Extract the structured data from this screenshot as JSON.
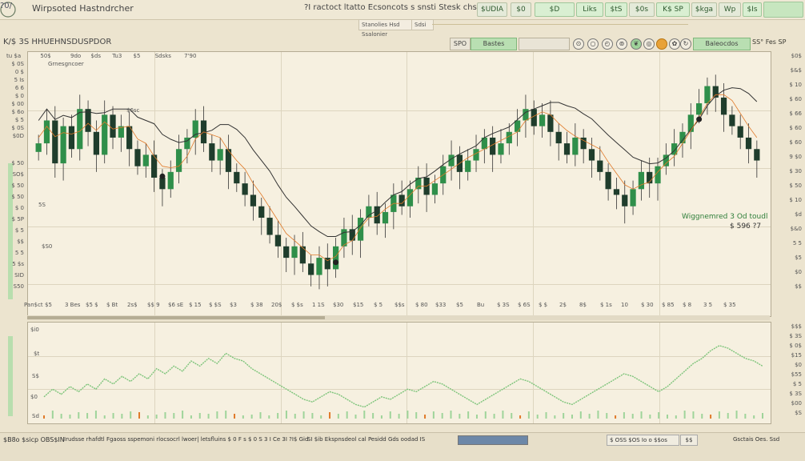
{
  "app": {
    "logo": "?0/",
    "title": "Wirpsoted Hastndrcher",
    "top_center": "?I ractoct ltatto Ecsoncots s snsti   Stesk  chs",
    "symbol_badge": "$UDIA"
  },
  "top_chips": [
    "$0",
    "$D",
    "Liks",
    "$tS",
    "$0s",
    "K$ SP",
    "$kga",
    "Wp",
    "$Is"
  ],
  "sub_fields": [
    "Stanolies Hsd Ssalonier",
    "Sdsi"
  ],
  "toolbar": {
    "symbol": "K/$ 3S HHUEHNSDUSPDOR",
    "btn_left": "SPO",
    "btn_left_green": "Bastes",
    "btn_right_green": "Baleocdos",
    "right_text": "SS° Fes SP"
  },
  "chart_header": [
    "tu $a",
    "50$",
    "9do",
    "$ds",
    "Tu3",
    "$5",
    "Sdsks",
    "7'90"
  ],
  "chart_note": "Grnesgncoer",
  "chart_note2": "$6sc",
  "annotation": {
    "line1": "Wiggnemred 3  Od toudl",
    "line2": "$ 596 ?7"
  },
  "price_axis": [
    "$0$",
    "$&$",
    "$ 10",
    "$ 60",
    "$ 66",
    "$ 60",
    "$ 60",
    "9 $0",
    "$ 30",
    "$ 50",
    "$ 10",
    "$d",
    "$&0",
    "5 5",
    "$5",
    "$0",
    "$$"
  ],
  "left_axis_upper": [
    "$ 0S",
    "0 $",
    "5 Is",
    "6 6",
    "$ 0",
    "$ 00",
    "$ 6o",
    "$ 5",
    "$ 0S",
    "$0D"
  ],
  "left_axis_lower": [
    "$ 50",
    "SO$",
    "$ 50",
    "$ 50",
    "$ 0",
    "$ 5P",
    "$ 5",
    "$$",
    "5 5",
    "5 $s",
    "SID",
    "S50"
  ],
  "mid_labels": [
    "5S",
    "$S0"
  ],
  "x_axis_labels": [
    "Pan$ct",
    "$5",
    "3 Bes",
    "$5 $",
    "$ Bt",
    "2s$",
    "$$ 9",
    "$6 sE",
    "$ 15",
    "$ $S",
    "$3",
    "$ 38",
    "20$",
    "$ $s",
    "1 1S",
    "$30",
    "$15",
    "$ 5",
    "$$s",
    "$ 80",
    "$33",
    "$5",
    "Bu",
    "$ 3S",
    "$ 6S",
    "$ $",
    "2$",
    "8$",
    "$ 1s",
    "10",
    "$ 30",
    "$ 85",
    "$ 8",
    "3 5",
    "$ 35"
  ],
  "lower_panel_labels": [
    "$i0",
    "$t",
    "S$",
    "$0",
    "Sd"
  ],
  "lower_right_axis": [
    "$$$",
    "$ 3S",
    "$ 0$",
    "$15",
    "$0",
    "$55",
    "$ 5",
    "$ 3S",
    "$00",
    "$S"
  ],
  "status": {
    "left": "$B8o  $sicp  OBS$IN",
    "mid": "Irudsse rhafdtl Fgaoss sspemoni rlocsocrl lwoer| letsfluins   $ 0 F s   $ 0 S 3 I Ce 3I    ?I$ Gid",
    "mid2": "SI    $ib  Ekspnsdeol  cal  Pesidd  Gds  oodad  IS",
    "progress_pct": 100,
    "right_box": "$ OSS  $OS  Io o  $$os",
    "right_box2": "$$",
    "far_right": "Gsctais  Oes. Ssd"
  },
  "colors": {
    "up": "#2f8f4a",
    "down": "#1f3d2c",
    "accent_green": "#7dc47a",
    "orange": "#e07a2a",
    "panel_bg": "#f6f0e0"
  },
  "chart_data": {
    "type": "candlestick",
    "title": "",
    "xlabel": "",
    "ylabel": "",
    "candle_closes": [
      62,
      70,
      55,
      68,
      60,
      74,
      66,
      58,
      72,
      64,
      68,
      60,
      54,
      58,
      50,
      46,
      52,
      60,
      64,
      70,
      62,
      56,
      60,
      52,
      48,
      44,
      40,
      36,
      30,
      26,
      22,
      26,
      20,
      16,
      22,
      18,
      26,
      32,
      28,
      36,
      40,
      34,
      38,
      44,
      40,
      46,
      50,
      44,
      48,
      54,
      58,
      52,
      56,
      60,
      64,
      58,
      62,
      66,
      70,
      74,
      68,
      72,
      66,
      62,
      58,
      64,
      60,
      56,
      52,
      46,
      44,
      40,
      46,
      52,
      48,
      54,
      58,
      62,
      66,
      72,
      76,
      82,
      78,
      72,
      68,
      64,
      60,
      56
    ],
    "oscillator": [
      42,
      48,
      44,
      50,
      46,
      52,
      48,
      56,
      52,
      58,
      54,
      60,
      56,
      64,
      60,
      66,
      62,
      70,
      66,
      72,
      68,
      76,
      72,
      70,
      64,
      60,
      56,
      52,
      48,
      44,
      40,
      38,
      42,
      46,
      44,
      40,
      36,
      34,
      38,
      42,
      40,
      44,
      48,
      46,
      50,
      54,
      52,
      48,
      44,
      40,
      36,
      40,
      44,
      48,
      52,
      56,
      54,
      50,
      46,
      42,
      38,
      36,
      40,
      44,
      48,
      52,
      56,
      60,
      58,
      54,
      50,
      46,
      50,
      56,
      62,
      68,
      72,
      78,
      82,
      80,
      76,
      72,
      70,
      66
    ]
  }
}
